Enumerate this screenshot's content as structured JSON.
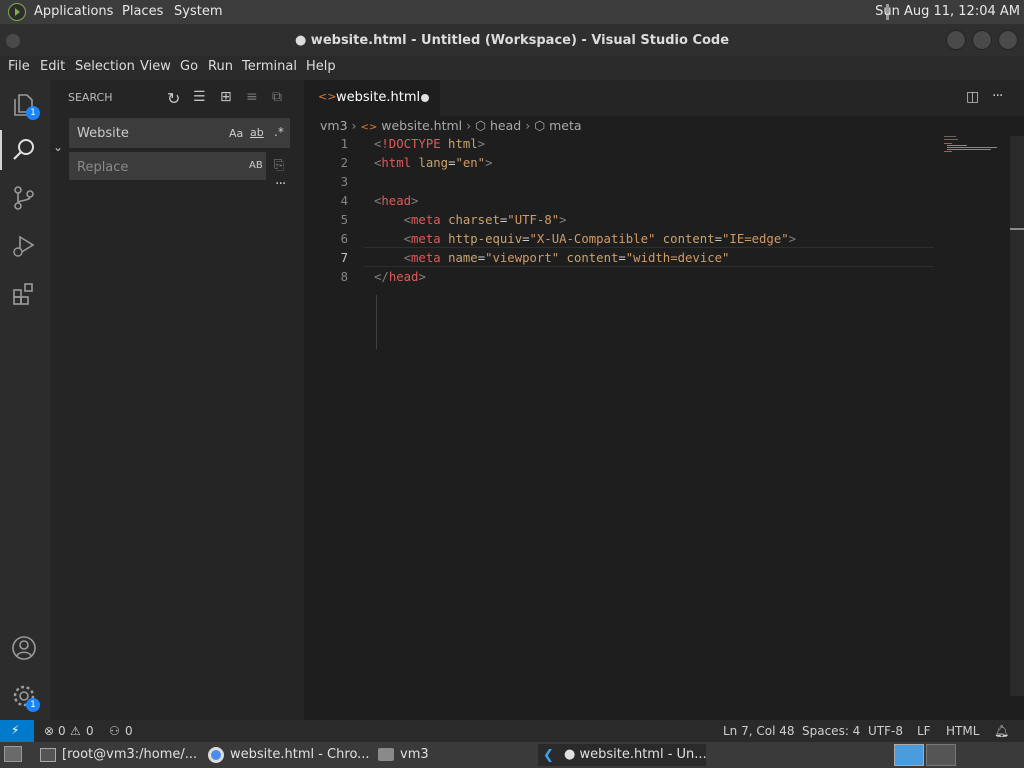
{
  "desktop": {
    "menus": [
      "Applications",
      "Places",
      "System"
    ],
    "clock": "Sun Aug 11, 12:04 AM"
  },
  "window": {
    "title": "● website.html - Untitled (Workspace) - Visual Studio Code"
  },
  "menubar": [
    "File",
    "Edit",
    "Selection",
    "View",
    "Go",
    "Run",
    "Terminal",
    "Help"
  ],
  "activity": {
    "explorer_badge": "1",
    "settings_badge": "1"
  },
  "sidebar": {
    "title": "SEARCH",
    "search_value": "Website",
    "replace_placeholder": "Replace",
    "match_case": "Aa",
    "whole_word": "ab",
    "regex": ".*",
    "preserve_case": "AB"
  },
  "editor": {
    "tab": {
      "name": "website.html",
      "modified": true
    },
    "breadcrumb": [
      "vm3",
      "website.html",
      "head",
      "meta"
    ],
    "lines": [
      {
        "n": "1",
        "text": "<!DOCTYPE html>"
      },
      {
        "n": "2",
        "text": "<html lang=\"en\">"
      },
      {
        "n": "3",
        "text": ""
      },
      {
        "n": "4",
        "text": "<head>"
      },
      {
        "n": "5",
        "text": "    <meta charset=\"UTF-8\">"
      },
      {
        "n": "6",
        "text": "    <meta http-equiv=\"X-UA-Compatible\" content=\"IE=edge\">"
      },
      {
        "n": "7",
        "text": "    <meta name=\"viewport\" content=\"width=device\""
      },
      {
        "n": "8",
        "text": "</head>"
      }
    ]
  },
  "statusbar": {
    "errors": "0",
    "warnings": "0",
    "ports": "0",
    "position": "Ln 7, Col 48",
    "spaces": "Spaces: 4",
    "encoding": "UTF-8",
    "eol": "LF",
    "language": "HTML"
  },
  "taskbar": {
    "items": [
      "[root@vm3:/home/...",
      "website.html - Chro...",
      "vm3",
      "● website.html - Un..."
    ]
  },
  "colors": {
    "accent": "#007acc",
    "tag": "#808080",
    "element": "#e05a5a",
    "attribute": "#c8a46d",
    "string": "#d19a66"
  }
}
